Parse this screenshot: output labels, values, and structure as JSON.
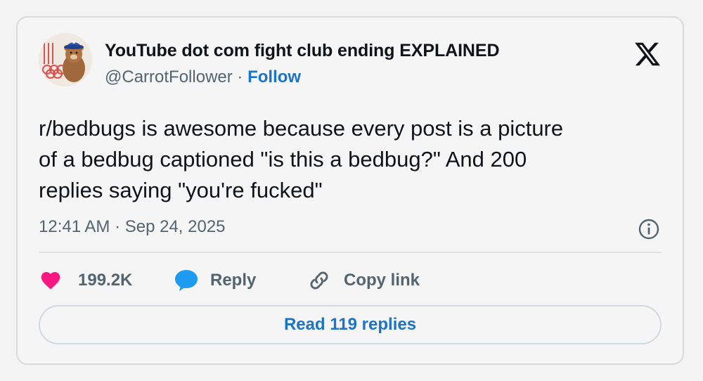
{
  "author": {
    "display_name": "YouTube dot com fight club ending EXPLAINED",
    "handle": "@CarrotFollower",
    "separator": "·",
    "follow_label": "Follow",
    "avatar_icon": "bear-mascot-avatar"
  },
  "brand": {
    "logo_icon": "x-logo-icon"
  },
  "tweet": {
    "text_lines": [
      "r/bedbugs is awesome because every post is a picture",
      "of a bedbug captioned \"is this a bedbug?\" And 200",
      "replies saying \"you're fucked\""
    ],
    "timestamp": "12:41 AM · Sep 24, 2025"
  },
  "actions": {
    "like_count": "199.2K",
    "reply_label": "Reply",
    "copy_link_label": "Copy link"
  },
  "footer": {
    "read_replies_label": "Read 119 replies"
  },
  "colors": {
    "accent": "#1d74c7",
    "heart": "#f91880",
    "reply_bubble": "#1d9bf0",
    "muted_text": "#536471"
  }
}
